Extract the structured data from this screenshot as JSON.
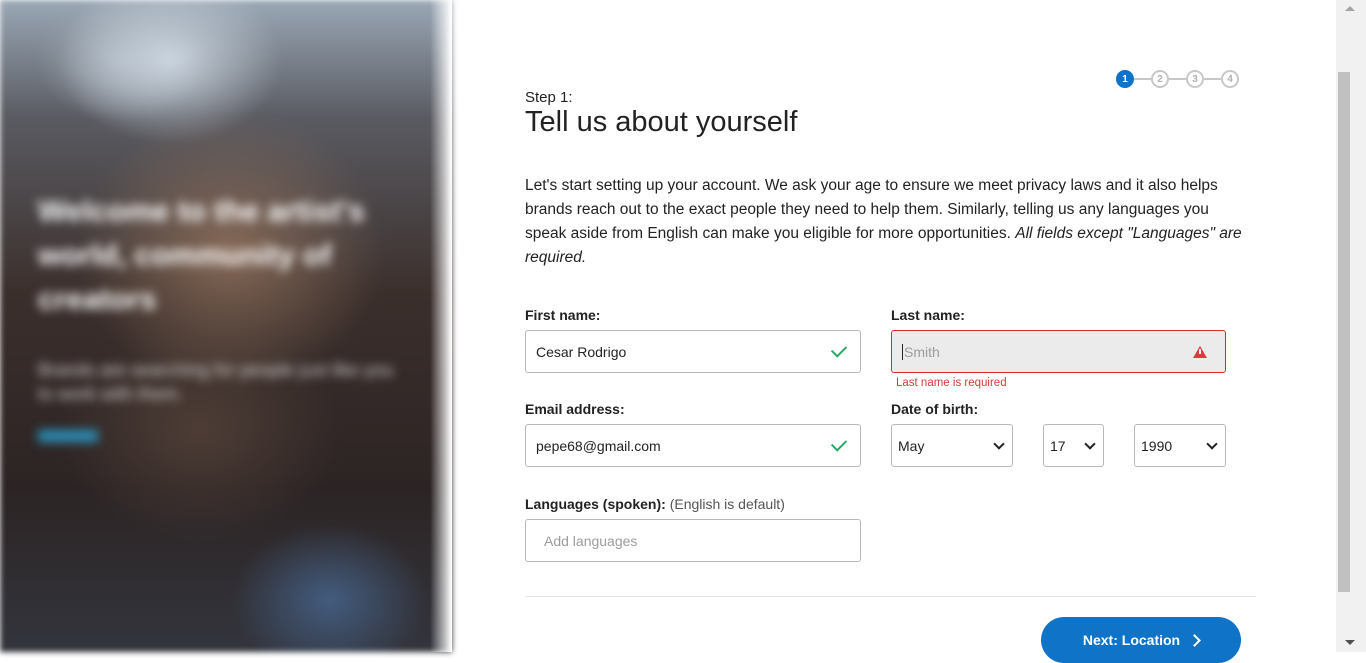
{
  "hero": {
    "title": "Welcome to the artist's world, community of creators",
    "subtitle": "Brands are searching for people just like you to work with them."
  },
  "progress": {
    "steps": [
      "1",
      "2",
      "3",
      "4"
    ],
    "current": 1
  },
  "header": {
    "step_label": "Step 1:",
    "title": "Tell us about yourself"
  },
  "intro": {
    "text": "Let's start setting up your account. We ask your age to ensure we meet privacy laws and it also helps brands reach out to the exact people they need to help them. Similarly, telling us any languages you speak aside from English can make you eligible for more opportunities. ",
    "note": "All fields except \"Languages\" are required."
  },
  "form": {
    "first_name": {
      "label": "First name:",
      "value": "Cesar Rodrigo"
    },
    "last_name": {
      "label": "Last name:",
      "placeholder": "Smith",
      "error": "Last name is required"
    },
    "email": {
      "label": "Email address:",
      "value": "pepe68@gmail.com"
    },
    "dob": {
      "label": "Date of birth:",
      "month": "May",
      "day": "17",
      "year": "1990"
    },
    "languages": {
      "label": "Languages (spoken):",
      "hint": "(English is default)",
      "placeholder": "Add languages"
    }
  },
  "actions": {
    "next_label": "Next: Location"
  },
  "colors": {
    "primary": "#0f73c8",
    "error": "#d92b2b",
    "success": "#2aa764"
  }
}
